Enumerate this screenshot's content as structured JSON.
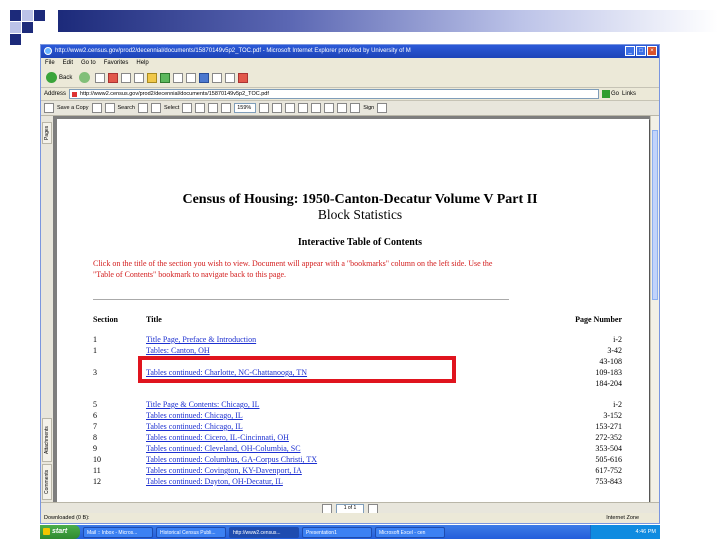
{
  "window": {
    "title": "http://www2.census.gov/prod2/decennial/documents/15870149v5p2_TOC.pdf - Microsoft Internet Explorer provided by University of M",
    "controls": [
      "_",
      "□",
      "×"
    ]
  },
  "menu": {
    "items": [
      "File",
      "Edit",
      "Go to",
      "Favorites",
      "Help"
    ]
  },
  "toolbar": {
    "back_label": "Back",
    "forward_label": ""
  },
  "address": {
    "label": "Address",
    "url": "http://www2.census.gov/prod2/decennial/documents/15870149v5p2_TOC.pdf",
    "go_label": "Go",
    "links_label": "Links"
  },
  "pdf_toolbar": {
    "save_copy": "Save a Copy",
    "print": "",
    "search": "Search",
    "select": "Select",
    "zoom_value": "159%",
    "sign": "Sign"
  },
  "side_tabs": {
    "pages": "Pages",
    "attachments": "Attachments",
    "comments": "Comments"
  },
  "document": {
    "title": "Census of Housing: 1950-Canton-Decatur Volume V Part II",
    "subtitle": "Block Statistics",
    "toc_heading": "Interactive Table of Contents",
    "instructions": "Click on the title of the section you wish to view.  Document will appear with a \"bookmarks\" column on the left side.  Use the \"Table of Contents\" bookmark to navigate back to this page.",
    "col_section": "Section",
    "col_title": "Title",
    "col_page": "Page Number",
    "rows": [
      {
        "section": "1",
        "title": "Title Page, Preface & Introduction",
        "pages": "i-2"
      },
      {
        "section": "1",
        "title": "Tables: Canton, OH",
        "pages": "3-42"
      },
      {
        "section": "",
        "title": "",
        "pages": "43-108"
      },
      {
        "section": "3",
        "title": "Tables continued: Charlotte, NC-Chattanooga, TN",
        "pages": "109-183"
      },
      {
        "section": "",
        "title": "",
        "pages": "184-204"
      },
      {
        "section": "5",
        "title": "Title Page & Contents: Chicago, IL",
        "pages": "i-2"
      },
      {
        "section": "6",
        "title": "Tables continued: Chicago, IL",
        "pages": "3-152"
      },
      {
        "section": "7",
        "title": "Tables continued: Chicago, IL",
        "pages": "153-271"
      },
      {
        "section": "8",
        "title": "Tables continued: Cicero, IL-Cincinnati, OH",
        "pages": "272-352"
      },
      {
        "section": "9",
        "title": "Tables continued: Cleveland, OH-Columbia, SC",
        "pages": "353-504"
      },
      {
        "section": "10",
        "title": "Tables continued: Columbus, GA-Corpus Christi, TX",
        "pages": "505-616"
      },
      {
        "section": "11",
        "title": "Tables continued: Covington, KY-Davenport, IA",
        "pages": "617-752"
      },
      {
        "section": "12",
        "title": "Tables continued: Dayton, OH-Decatur, IL",
        "pages": "753-843"
      }
    ]
  },
  "pdf_status": {
    "page_indicator": "1 of 1"
  },
  "status": {
    "left": "Downloaded (0 B):",
    "zone": "Internet Zone"
  },
  "taskbar": {
    "start": "start",
    "tasks": [
      "Mail :: Inbox - Micros...",
      "Historical Census Publi...",
      "http://www2.census...",
      "Presentation1",
      "Microsoft Excel - cen"
    ],
    "clock": "4:46 PM"
  },
  "colors": {
    "highlight": "#e0141e",
    "link": "#1c2fd0",
    "instruction": "#d21b1b"
  }
}
